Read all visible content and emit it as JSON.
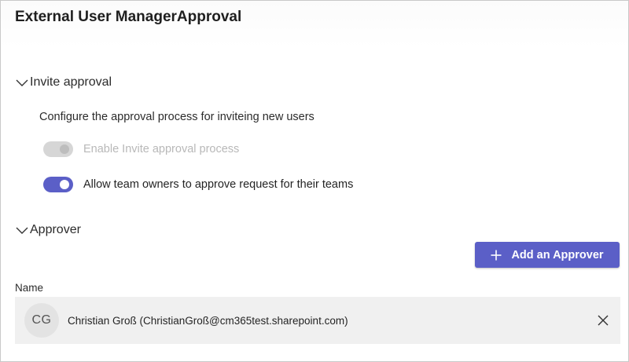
{
  "page": {
    "title": "External User ManagerApproval"
  },
  "invite_approval": {
    "header": "Invite approval",
    "description": "Configure the approval process for inviteing new users",
    "toggles": [
      {
        "label": "Enable Invite approval process",
        "state": "on",
        "disabled": true
      },
      {
        "label": "Allow team owners to approve request for their teams",
        "state": "on",
        "disabled": false
      }
    ]
  },
  "approver": {
    "header": "Approver",
    "add_button_label": "Add an Approver",
    "column_name": "Name",
    "items": [
      {
        "initials": "CG",
        "display": "Christian Groß (ChristianGroß@cm365test.sharepoint.com)"
      }
    ]
  },
  "colors": {
    "accent": "#5b5fc7",
    "row_background": "#f0f0f0",
    "disabled_text": "#b8b8b8"
  }
}
